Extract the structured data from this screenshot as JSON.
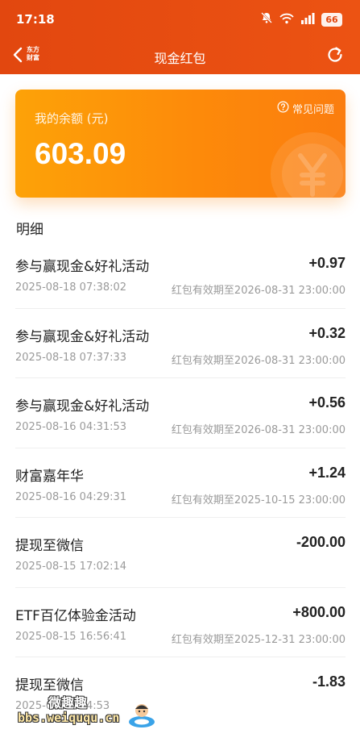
{
  "status_bar": {
    "time": "17:18",
    "battery": "66",
    "icons": [
      "mute-bell-icon",
      "wifi-icon",
      "signal-icon",
      "battery-icon"
    ]
  },
  "nav": {
    "title": "现金红包",
    "logo_line1": "东方",
    "logo_line2": "财富",
    "back_icon": "chevron-left-icon",
    "refresh_icon": "refresh-icon"
  },
  "balance": {
    "label": "我的余额 (元)",
    "amount": "603.09",
    "faq_label": "常见问题"
  },
  "section": {
    "title": "明细"
  },
  "transactions": [
    {
      "title": "参与赢现金&好礼活动",
      "amount": "+0.97",
      "time": "2025-08-18 07:38:02",
      "expiry": "红包有效期至2026-08-31 23:00:00"
    },
    {
      "title": "参与赢现金&好礼活动",
      "amount": "+0.32",
      "time": "2025-08-18 07:37:33",
      "expiry": "红包有效期至2026-08-31 23:00:00"
    },
    {
      "title": "参与赢现金&好礼活动",
      "amount": "+0.56",
      "time": "2025-08-16 04:31:53",
      "expiry": "红包有效期至2026-08-31 23:00:00"
    },
    {
      "title": "财富嘉年华",
      "amount": "+1.24",
      "time": "2025-08-16 04:29:31",
      "expiry": "红包有效期至2025-10-15 23:00:00"
    },
    {
      "title": "提现至微信",
      "amount": "-200.00",
      "time": "2025-08-15 17:02:14",
      "expiry": ""
    },
    {
      "title": "ETF百亿体验金活动",
      "amount": "+800.00",
      "time": "2025-08-15 16:56:41",
      "expiry": "红包有效期至2025-12-31 23:00:00"
    },
    {
      "title": "提现至微信",
      "amount": "-1.83",
      "time": "2025-08-15 14:53",
      "expiry": ""
    }
  ],
  "watermark": {
    "title": "微趣趣",
    "url": "bbs.weiququ.cn"
  },
  "colors": {
    "header": "#e2470f",
    "card_start": "#fda208",
    "card_end": "#fb7d0f"
  }
}
